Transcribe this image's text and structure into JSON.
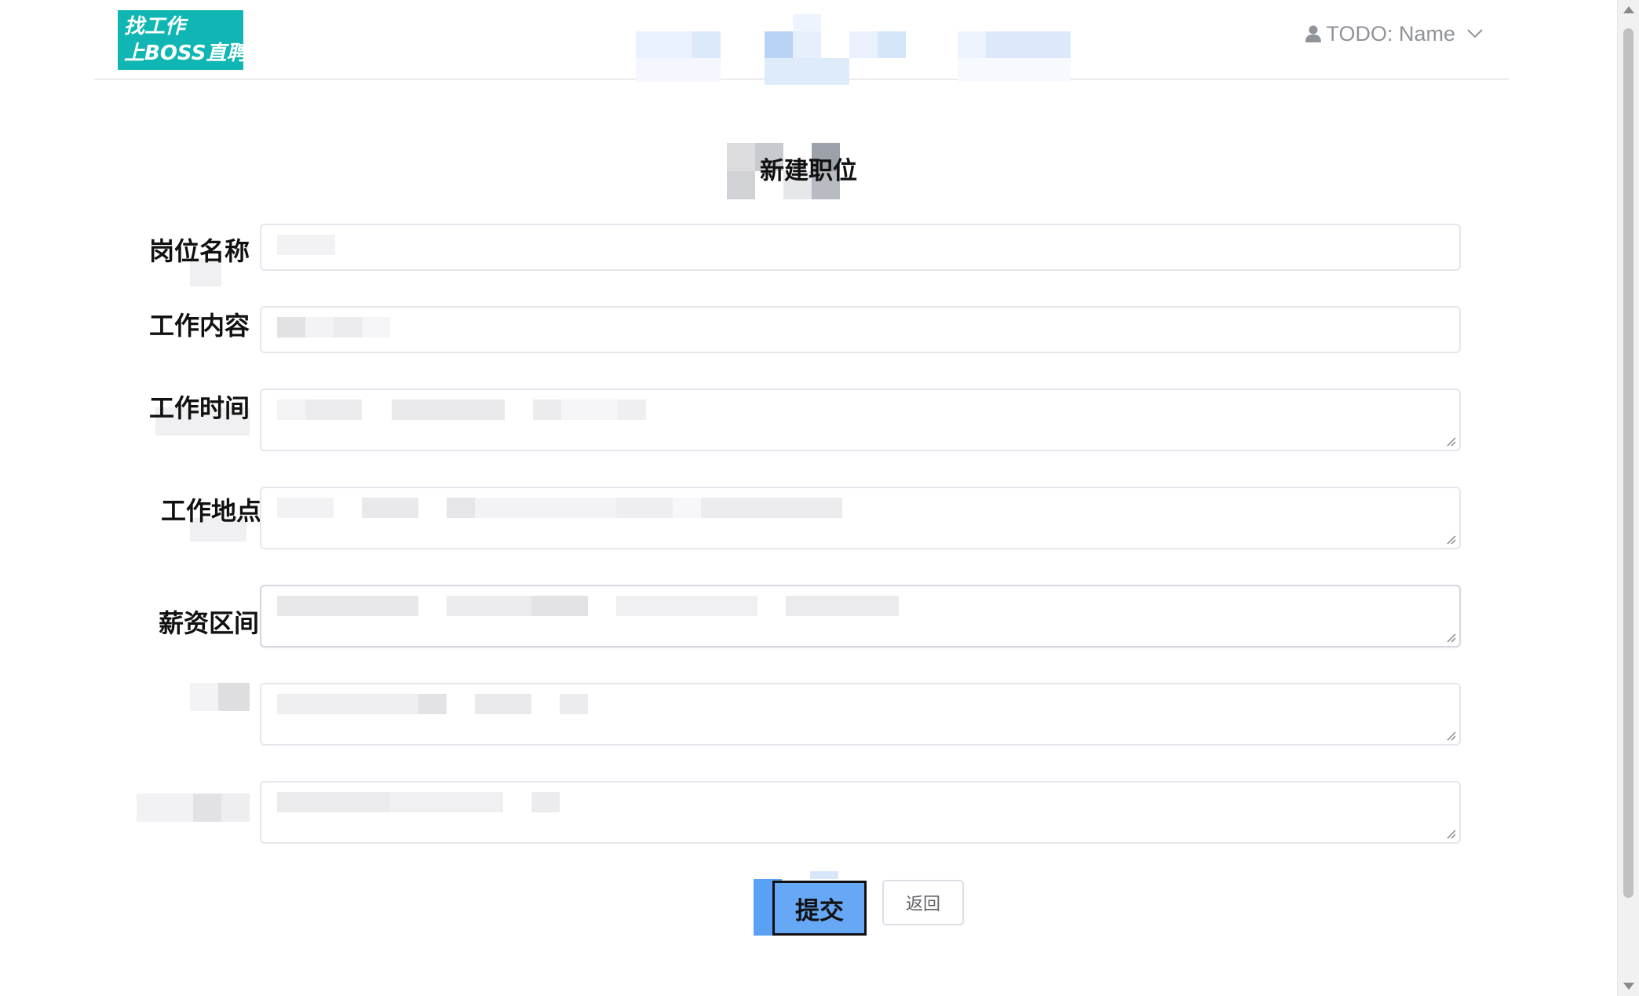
{
  "header": {
    "logo_line1": "找工作",
    "logo_line2": "上BOSS直聘",
    "user_label": "TODO: Name"
  },
  "page": {
    "title": "新建职位"
  },
  "form": {
    "fields": [
      {
        "label": "岗位名称"
      },
      {
        "label": "工作内容"
      },
      {
        "label": "工作时间"
      },
      {
        "label": "工作地点"
      },
      {
        "label": "薪资区间"
      },
      {
        "label": ""
      },
      {
        "label": ""
      }
    ]
  },
  "actions": {
    "submit_label": "提交",
    "back_label": "返回"
  },
  "colors": {
    "logo_bg": "#10b6b3",
    "primary": "#409eff",
    "border": "#e4e7ed",
    "muted_text": "#909399"
  }
}
